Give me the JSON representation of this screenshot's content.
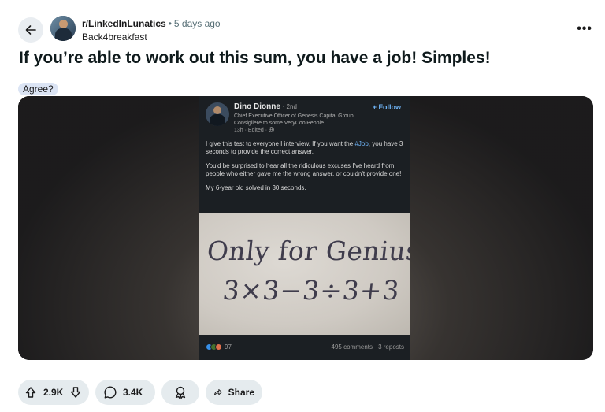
{
  "header": {
    "subreddit": "r/LinkedInLunatics",
    "separator": "•",
    "time_ago": "5 days ago",
    "author": "Back4breakfast",
    "more_label": "•••"
  },
  "post": {
    "title": "If you’re able to work out this sum, you have a job! Simples!",
    "flair": "Agree?"
  },
  "embedded_post": {
    "name": "Dino Dionne",
    "degree": "· 2nd",
    "headline": "Chief Executive Officer of Genesis Capital Group. Consigliere to some VeryCoolPeople",
    "time": "13h · Edited ·",
    "follow_label": "+ Follow",
    "para1_before": "I give this test to everyone I interview. If you want the ",
    "para1_hashtag": "#Job",
    "para1_after": ", you have 3 seconds to provide the correct answer.",
    "para2": "You'd be surprised to hear all the ridiculous excuses I've heard from people who either gave me the wrong answer, or couldn't provide one!",
    "para3": "My 6-year old solved in 30 seconds.",
    "image_line1": "Only for Genius",
    "image_line2": "3×3−3÷3+3",
    "reaction_count": "97",
    "stats": "495 comments  ·  3 reposts"
  },
  "actions": {
    "upvotes": "2.9K",
    "comments": "3.4K",
    "share": "Share"
  },
  "colors": {
    "pill_bg": "#e5ebee",
    "flair_bg": "#dbe4f4",
    "link_blue": "#71b7fb"
  }
}
